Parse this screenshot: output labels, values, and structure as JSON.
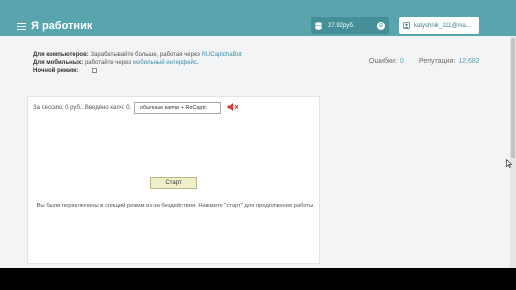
{
  "header": {
    "title": "Я работник",
    "balance": "27.92руб.",
    "balance_action": "⊖",
    "user": "katyshnik_111@ma..."
  },
  "info": {
    "computers_label": "Для компьютеров:",
    "computers_text": "Зарабатывайте больше, работая через",
    "computers_link": "RUCaptchaBot",
    "mobile_label": "Для мобильных:",
    "mobile_text": "работайте через",
    "mobile_link": "мобильный интерфейс",
    "mobile_tail": ".",
    "night_label": "Ночной режим:"
  },
  "stats": {
    "errors_label": "Ошибки:",
    "errors_value": "0",
    "reputation_label": "Репутация:",
    "reputation_value": "12,682"
  },
  "panel": {
    "session_text": "За сессию:  0 руб.. Введено капч:  0.",
    "captcha_type": "обычные капчи + ReCaptc",
    "start_label": "Старт",
    "sleep_message": "Вы были переключены в спящий режим из-за бездействия. Нажмите \"старт\" для продолжения работы"
  },
  "icons": {
    "menu": "menu-icon",
    "balance": "database-icon",
    "user": "user-icon",
    "sound": "speaker-muted-icon",
    "cursor": "mouse-cursor-icon"
  },
  "colors": {
    "header": "#59a5ae",
    "link": "#3b8fa6",
    "start_button": "#f0f0c8",
    "speaker": "#d93a2b"
  }
}
